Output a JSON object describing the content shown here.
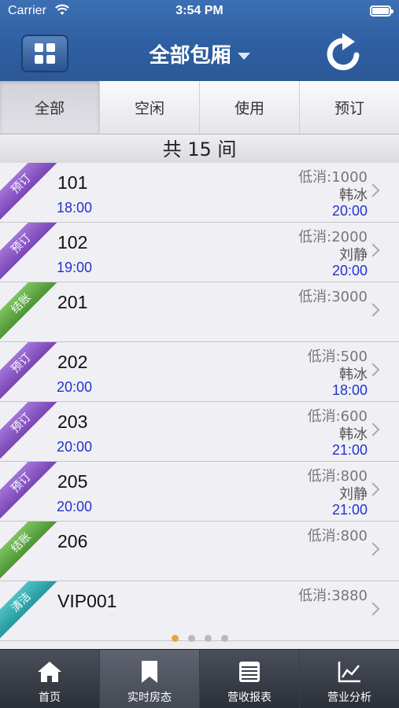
{
  "status": {
    "carrier": "Carrier",
    "time": "3:54 PM"
  },
  "nav": {
    "title": "全部包厢"
  },
  "filters": [
    "全部",
    "空闲",
    "使用",
    "预订"
  ],
  "count_text": "共 15 间",
  "rooms": [
    {
      "tag": "预订",
      "tag_color": "#8a55c8",
      "room": "101",
      "start": "18:00",
      "min": "低消:1000",
      "staff": "韩冰",
      "end": "20:00"
    },
    {
      "tag": "预订",
      "tag_color": "#8a55c8",
      "room": "102",
      "start": "19:00",
      "min": "低消:2000",
      "staff": "刘静",
      "end": "20:00"
    },
    {
      "tag": "结账",
      "tag_color": "#5aa83e",
      "room": "201",
      "start": "",
      "min": "低消:3000",
      "staff": "",
      "end": ""
    },
    {
      "tag": "预订",
      "tag_color": "#8a55c8",
      "room": "202",
      "start": "20:00",
      "min": "低消:500",
      "staff": "韩冰",
      "end": "18:00"
    },
    {
      "tag": "预订",
      "tag_color": "#8a55c8",
      "room": "203",
      "start": "20:00",
      "min": "低消:600",
      "staff": "韩冰",
      "end": "21:00"
    },
    {
      "tag": "预订",
      "tag_color": "#8a55c8",
      "room": "205",
      "start": "20:00",
      "min": "低消:800",
      "staff": "刘静",
      "end": "21:00"
    },
    {
      "tag": "结账",
      "tag_color": "#5aa83e",
      "room": "206",
      "start": "",
      "min": "低消:800",
      "staff": "",
      "end": ""
    },
    {
      "tag": "清洁",
      "tag_color": "#2fa9ad",
      "room": "VIP001",
      "start": "",
      "min": "低消:3880",
      "staff": "",
      "end": ""
    }
  ],
  "tabbar": [
    {
      "label": "首页",
      "icon": "home-icon"
    },
    {
      "label": "实时房态",
      "icon": "bookmark-icon"
    },
    {
      "label": "营收报表",
      "icon": "report-icon"
    },
    {
      "label": "营业分析",
      "icon": "chart-icon"
    }
  ],
  "colors": {
    "header": "#2f5fa3",
    "accent_time": "#2233cc",
    "page_dot_active": "#e4a63a"
  }
}
